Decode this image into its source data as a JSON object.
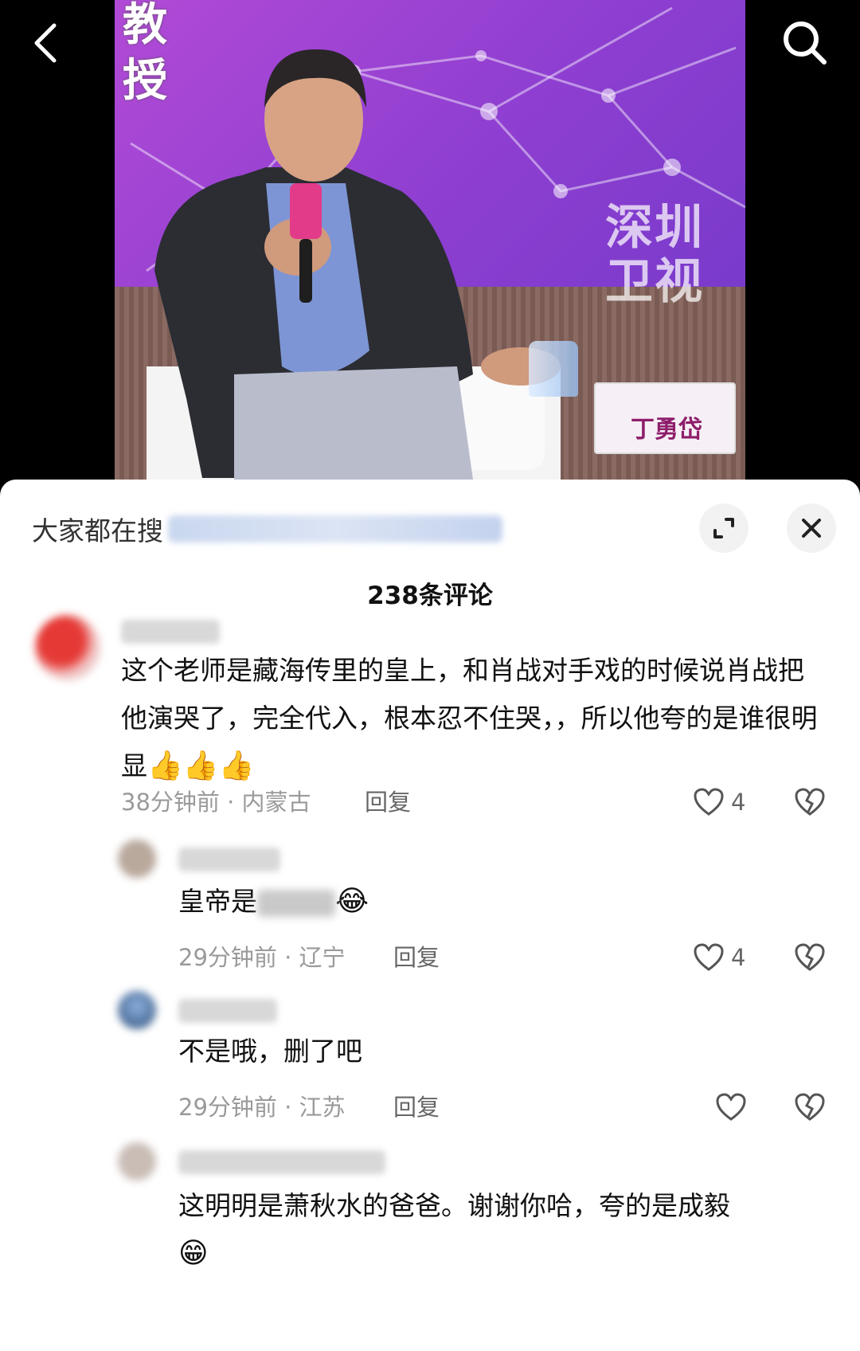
{
  "video": {
    "caption": "教授",
    "watermark": "深圳卫视",
    "placard_name": "丁勇岱"
  },
  "icons": {
    "back": "chevron-left-icon",
    "search": "search-icon",
    "expand": "expand-icon",
    "close": "close-icon",
    "like": "heart-icon",
    "dislike": "broken-heart-icon"
  },
  "sheet": {
    "search_suggestion_label": "大家都在搜",
    "comment_count": "238条评论"
  },
  "comments": [
    {
      "text": "这个老师是藏海传里的皇上，和肖战对手戏的时候说肖战把他演哭了，完全代入，根本忍不住哭，，所以他夸的是谁很明显",
      "emojis": "👍👍👍",
      "meta": "38分钟前 · 内蒙古",
      "reply_label": "回复",
      "likes": "4"
    },
    {
      "text_before": "皇帝是",
      "text_after": "",
      "emoji": "😂",
      "meta": "29分钟前 · 辽宁",
      "reply_label": "回复",
      "likes": "4"
    },
    {
      "text": "不是哦，删了吧",
      "meta": "29分钟前 · 江苏",
      "reply_label": "回复",
      "likes": ""
    },
    {
      "text": "这明明是萧秋水的爸爸。谢谢你哈，夸的是成毅",
      "emoji": "😁"
    }
  ],
  "colors": {
    "video_bg": "#8f3fd1",
    "sheet_bg": "#ffffff",
    "text_primary": "#111111",
    "text_meta": "#9a9a9a"
  }
}
